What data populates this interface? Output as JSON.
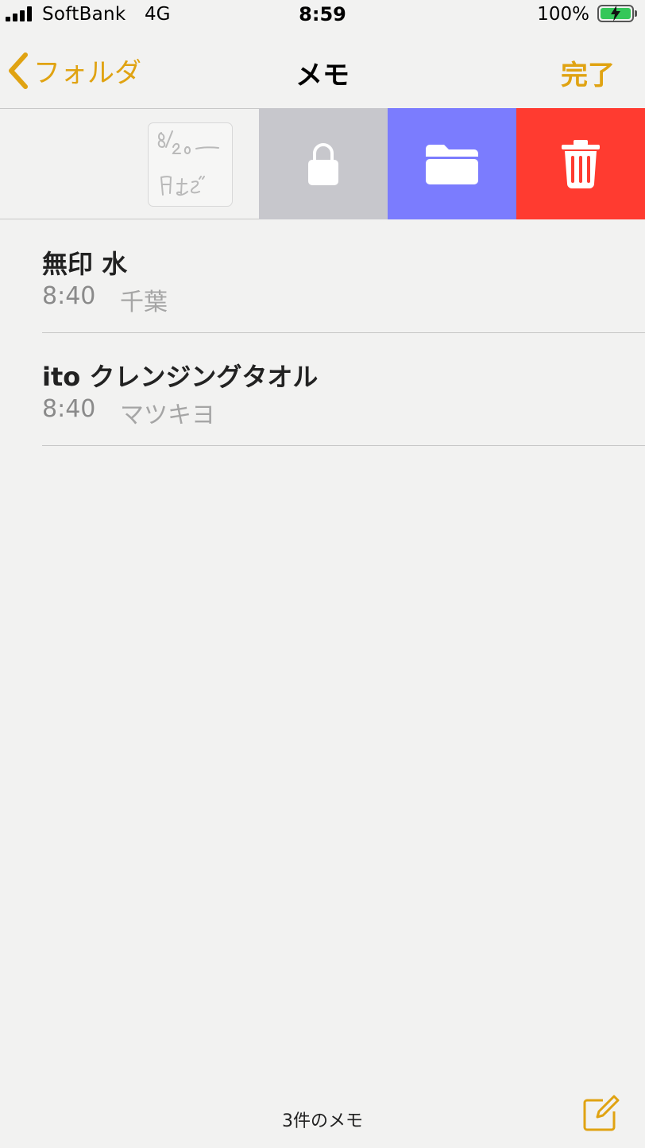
{
  "status": {
    "carrier": "SoftBank",
    "network": "4G",
    "time": "8:59",
    "battery": "100%",
    "battery_level": 1.0
  },
  "nav": {
    "back_label": "フォルダ",
    "title": "メモ",
    "done_label": "完了"
  },
  "swiped_note": {
    "actions": [
      "lock-icon",
      "folder-icon",
      "trash-icon"
    ]
  },
  "notes": [
    {
      "title": "無印 水",
      "time": "8:40",
      "preview": "千葉"
    },
    {
      "title": "ito クレンジングタオル",
      "time": "8:40",
      "preview": "マツキヨ"
    }
  ],
  "footer": {
    "count": "3件のメモ"
  },
  "colors": {
    "accent": "#e0a312",
    "lock_action": "#c7c7cc",
    "move_action": "#7b7cfe",
    "delete_action": "#ff3b30",
    "background": "#f2f2f1"
  }
}
